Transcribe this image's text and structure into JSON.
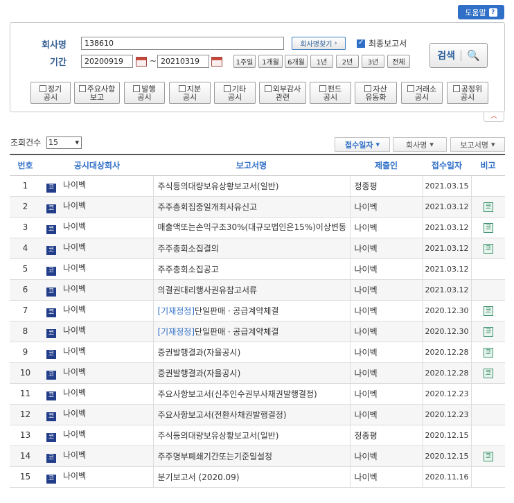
{
  "help": {
    "label": "도움말",
    "icon": "question-icon"
  },
  "search": {
    "company_label": "회사명",
    "company_value": "138610",
    "find_company_label": "회사명찾기",
    "final_report_label": "최종보고서",
    "final_report_checked": true,
    "period_label": "기간",
    "date_from": "20200919",
    "date_to": "20210319",
    "date_sep": "~",
    "periods": [
      "1주일",
      "1개월",
      "6개월",
      "1년",
      "2년",
      "3년",
      "전체"
    ],
    "search_label": "검색",
    "types": [
      [
        "정기",
        "공시"
      ],
      [
        "주요사항",
        "보고"
      ],
      [
        "발행",
        "공시"
      ],
      [
        "지분",
        "공시"
      ],
      [
        "기타",
        "공시"
      ],
      [
        "외부감사",
        "관련"
      ],
      [
        "펀드",
        "공시"
      ],
      [
        "자산",
        "유동화"
      ],
      [
        "거래소",
        "공시"
      ],
      [
        "공정위",
        "공시"
      ]
    ]
  },
  "list": {
    "count_label": "조회건수",
    "count_value": "15",
    "sort": [
      "접수일자",
      "회사명",
      "보고서명"
    ],
    "headers": [
      "번호",
      "공시대상회사",
      "보고서명",
      "제출인",
      "접수일자",
      "비고"
    ],
    "market_badge": "코",
    "rows": [
      {
        "no": "1",
        "company": "나이벡",
        "prefix": "",
        "report": "주식등의대량보유상황보고서(일반)",
        "submitter": "정종평",
        "date": "2021.03.15",
        "remark": ""
      },
      {
        "no": "2",
        "company": "나이벡",
        "prefix": "",
        "report": "주주총회집중일개최사유신고",
        "submitter": "나이벡",
        "date": "2021.03.12",
        "remark": "코"
      },
      {
        "no": "3",
        "company": "나이벡",
        "prefix": "",
        "report": "매출액또는손익구조30%(대규모법인은15%)이상변동",
        "submitter": "나이벡",
        "date": "2021.03.12",
        "remark": "코"
      },
      {
        "no": "4",
        "company": "나이벡",
        "prefix": "",
        "report": "주주총회소집결의",
        "submitter": "나이벡",
        "date": "2021.03.12",
        "remark": "코"
      },
      {
        "no": "5",
        "company": "나이벡",
        "prefix": "",
        "report": "주주총회소집공고",
        "submitter": "나이벡",
        "date": "2021.03.12",
        "remark": ""
      },
      {
        "no": "6",
        "company": "나이벡",
        "prefix": "",
        "report": "의결권대리행사권유참고서류",
        "submitter": "나이벡",
        "date": "2021.03.12",
        "remark": ""
      },
      {
        "no": "7",
        "company": "나이벡",
        "prefix": "[기재정정]",
        "report": "단일판매ㆍ공급계약체결",
        "submitter": "나이벡",
        "date": "2020.12.30",
        "remark": "코"
      },
      {
        "no": "8",
        "company": "나이벡",
        "prefix": "[기재정정]",
        "report": "단일판매ㆍ공급계약체결",
        "submitter": "나이벡",
        "date": "2020.12.30",
        "remark": "코"
      },
      {
        "no": "9",
        "company": "나이벡",
        "prefix": "",
        "report": "증권발행결과(자율공시)",
        "submitter": "나이벡",
        "date": "2020.12.28",
        "remark": "코"
      },
      {
        "no": "10",
        "company": "나이벡",
        "prefix": "",
        "report": "증권발행결과(자율공시)",
        "submitter": "나이벡",
        "date": "2020.12.28",
        "remark": "코"
      },
      {
        "no": "11",
        "company": "나이벡",
        "prefix": "",
        "report": "주요사항보고서(신주인수권부사채권발행결정)",
        "submitter": "나이벡",
        "date": "2020.12.23",
        "remark": ""
      },
      {
        "no": "12",
        "company": "나이벡",
        "prefix": "",
        "report": "주요사항보고서(전환사채권발행결정)",
        "submitter": "나이벡",
        "date": "2020.12.23",
        "remark": ""
      },
      {
        "no": "13",
        "company": "나이벡",
        "prefix": "",
        "report": "주식등의대량보유상황보고서(일반)",
        "submitter": "정종평",
        "date": "2020.12.15",
        "remark": ""
      },
      {
        "no": "14",
        "company": "나이벡",
        "prefix": "",
        "report": "주주명부폐쇄기간또는기준일설정",
        "submitter": "나이벡",
        "date": "2020.12.15",
        "remark": "코"
      },
      {
        "no": "15",
        "company": "나이벡",
        "prefix": "",
        "report": "분기보고서 (2020.09)",
        "submitter": "나이벡",
        "date": "2020.11.16",
        "remark": ""
      }
    ]
  },
  "colors": {
    "accent": "#2f6fc7",
    "label": "#345e91",
    "badge": "#223e8a"
  }
}
